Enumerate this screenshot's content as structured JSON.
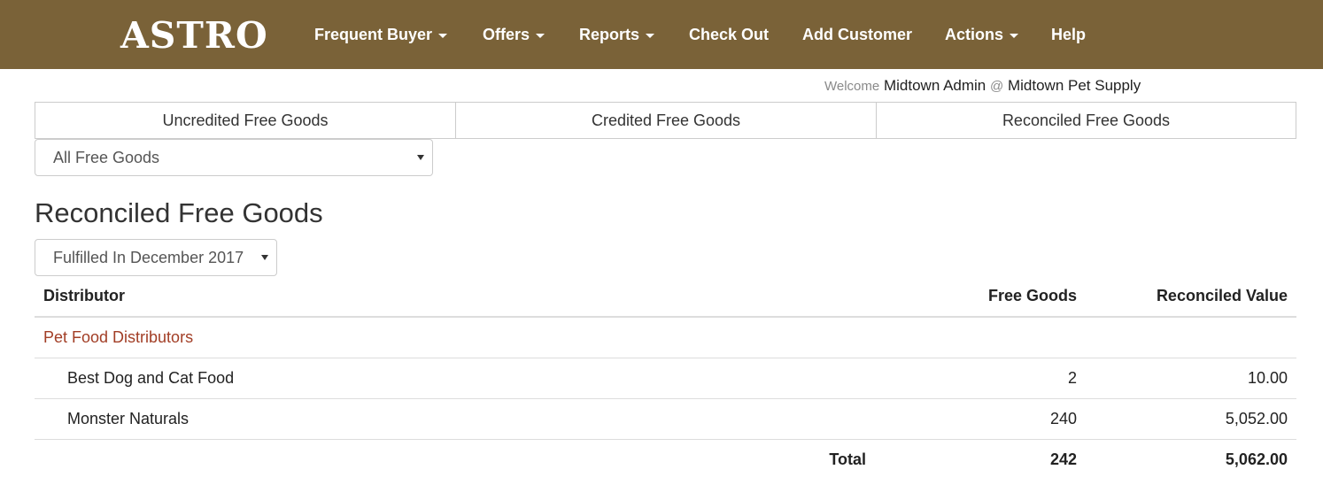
{
  "navbar": {
    "brand": "ASTRO",
    "items": [
      {
        "label": "Frequent Buyer",
        "dropdown": true
      },
      {
        "label": "Offers",
        "dropdown": true
      },
      {
        "label": "Reports",
        "dropdown": true
      },
      {
        "label": "Check Out",
        "dropdown": false
      },
      {
        "label": "Add Customer",
        "dropdown": false
      },
      {
        "label": "Actions",
        "dropdown": true
      },
      {
        "label": "Help",
        "dropdown": false
      }
    ],
    "background_color": "#7a6238"
  },
  "welcome": {
    "prefix": "Welcome",
    "user": "Midtown Admin",
    "at": "@",
    "store": "Midtown Pet Supply"
  },
  "tabs": [
    {
      "label": "Uncredited Free Goods"
    },
    {
      "label": "Credited Free Goods"
    },
    {
      "label": "Reconciled Free Goods"
    }
  ],
  "filter_select": {
    "selected": "All Free Goods"
  },
  "page_title": "Reconciled Free Goods",
  "period_select": {
    "selected": "Fulfilled In December 2017"
  },
  "table": {
    "columns": [
      "Distributor",
      "Free Goods",
      "Reconciled Value"
    ],
    "group": {
      "label": "Pet Food Distributors",
      "color": "#a23e26"
    },
    "rows": [
      {
        "distributor": "Best Dog and Cat Food",
        "free_goods": "2",
        "reconciled_value": "10.00"
      },
      {
        "distributor": "Monster Naturals",
        "free_goods": "240",
        "reconciled_value": "5,052.00"
      }
    ],
    "total": {
      "label": "Total",
      "free_goods": "242",
      "reconciled_value": "5,062.00"
    }
  }
}
